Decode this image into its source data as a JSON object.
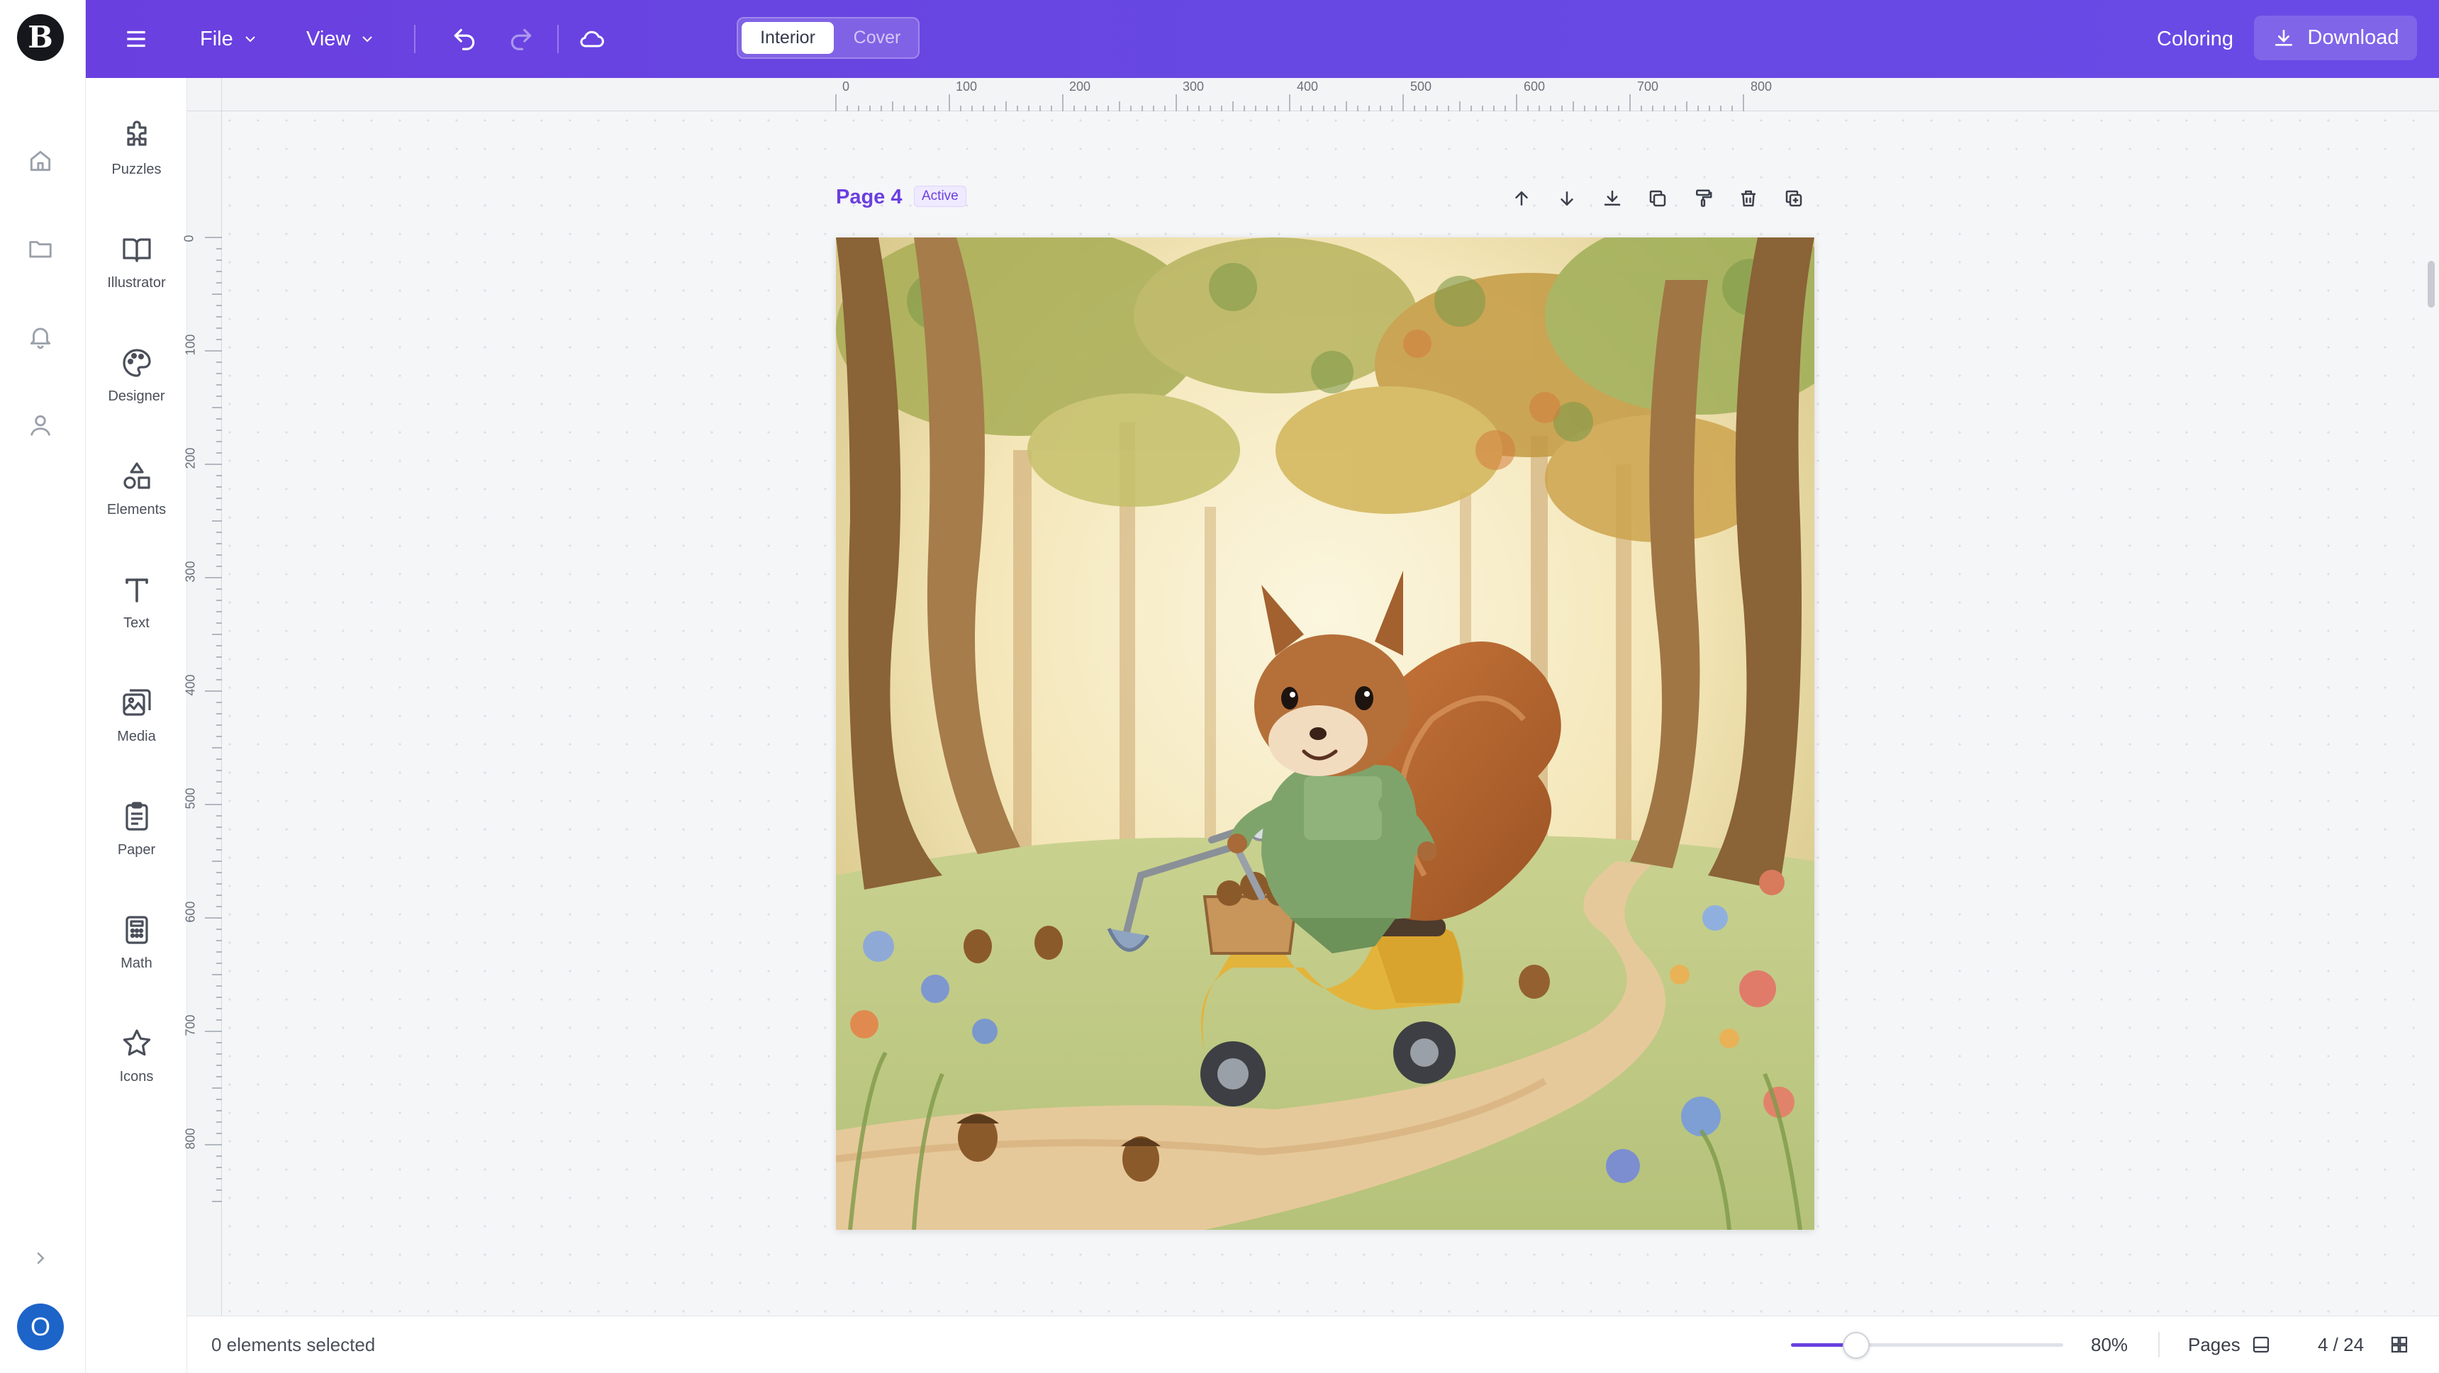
{
  "app": {
    "logo_letter": "B",
    "avatar_initial": "O",
    "brand_color": "#6a3fe0"
  },
  "rail": {
    "items": [
      {
        "name": "home",
        "icon": "home-icon"
      },
      {
        "name": "folders",
        "icon": "folder-icon"
      },
      {
        "name": "notifications",
        "icon": "bell-icon"
      },
      {
        "name": "profile",
        "icon": "user-icon"
      }
    ],
    "expand_icon": "chevron-right-icon"
  },
  "topbar": {
    "file_label": "File",
    "view_label": "View",
    "seg_interior": "Interior",
    "seg_cover": "Cover",
    "selected_segment": "Interior",
    "mode_label": "Coloring",
    "download_label": "Download"
  },
  "tools": {
    "puzzles": "Puzzles",
    "illustrator": "Illustrator",
    "designer": "Designer",
    "elements": "Elements",
    "text": "Text",
    "media": "Media",
    "paper": "Paper",
    "math": "Math",
    "icons": "Icons"
  },
  "rulers": {
    "top": [
      "0",
      "100",
      "200",
      "300",
      "400",
      "500",
      "600",
      "700",
      "800"
    ],
    "left": [
      "0",
      "100",
      "200",
      "300",
      "400",
      "500",
      "600",
      "700",
      "800"
    ]
  },
  "page": {
    "title": "Page 4",
    "badge": "Active",
    "actions": [
      "arrow-up-icon",
      "arrow-down-icon",
      "download-icon",
      "duplicate-icon",
      "paint-roller-icon",
      "trash-icon",
      "add-page-icon"
    ],
    "illustration": "Watercolor squirrel in green overalls riding a yellow scooter with a basket of acorns along a forest path"
  },
  "bottombar": {
    "selection": "0 elements selected",
    "zoom_percent": 80,
    "zoom_label": "80%",
    "zoom_slider_fraction": 0.24,
    "pages_label": "Pages",
    "page_counter": "4 / 24"
  }
}
